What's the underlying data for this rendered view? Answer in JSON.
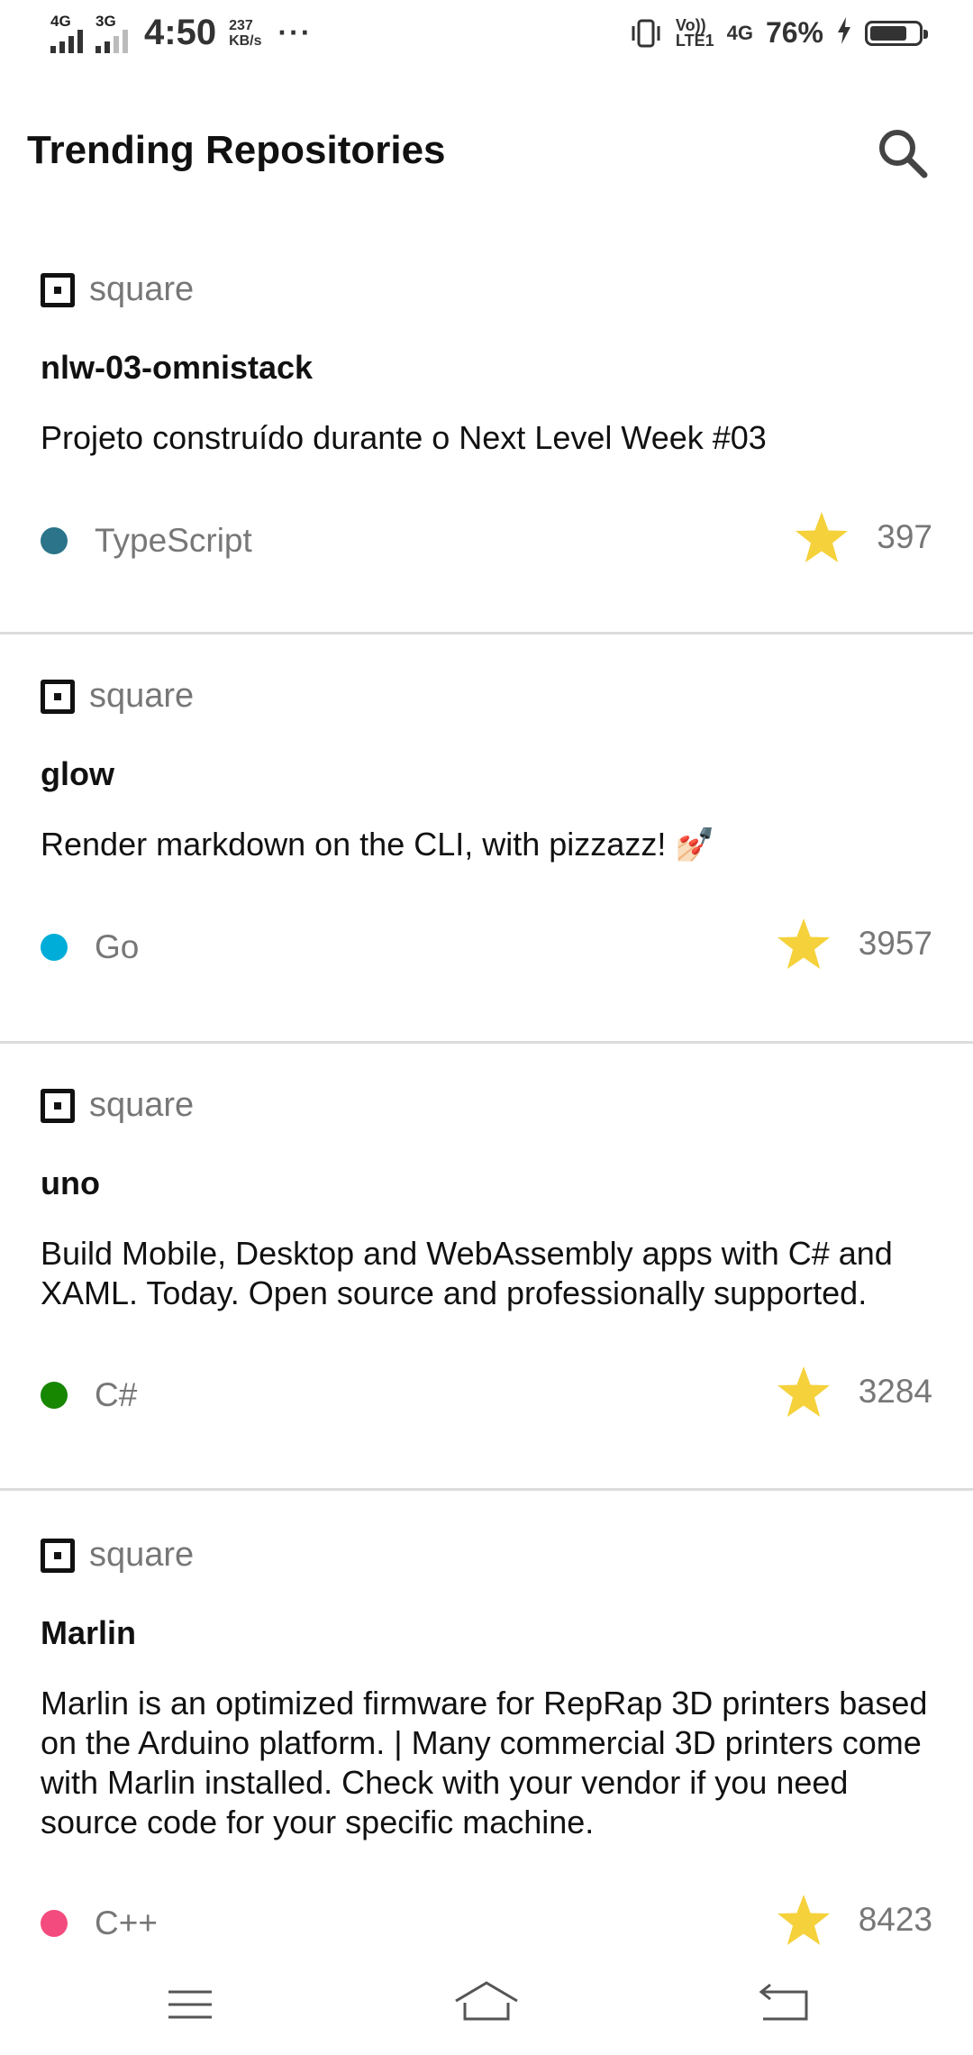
{
  "status_bar": {
    "sim1": "4G",
    "sim2": "3G",
    "time": "4:50",
    "speed_value": "237",
    "speed_unit": "KB/s",
    "more": "···",
    "volte_top": "Vo))",
    "volte_bottom": "LTE1",
    "network": "4G",
    "battery_percent": "76%",
    "battery_level": 0.76
  },
  "app_bar": {
    "title": "Trending Repositories",
    "search_icon": "search-icon"
  },
  "repositories": [
    {
      "owner": "square",
      "name": "nlw-03-omnistack",
      "description": "Projeto construído durante o Next Level Week #03",
      "language": "TypeScript",
      "language_color": "#2b7489",
      "stars": "397"
    },
    {
      "owner": "square",
      "name": "glow",
      "description": "Render markdown on the CLI, with pizzazz! 💅🏻",
      "language": "Go",
      "language_color": "#00ADD8",
      "stars": "3957"
    },
    {
      "owner": "square",
      "name": "uno",
      "description": "Build Mobile, Desktop and WebAssembly apps with C# and XAML. Today. Open source and professionally supported.",
      "language": "C#",
      "language_color": "#178600",
      "stars": "3284"
    },
    {
      "owner": "square",
      "name": "Marlin",
      "description": "Marlin is an optimized firmware for RepRap 3D printers based on the Arduino platform. | Many commercial 3D printers come with Marlin installed. Check with your vendor if you need source code for your specific machine.",
      "language": "C++",
      "language_color": "#f34b7d",
      "stars": "8423"
    }
  ],
  "colors": {
    "star": "#f5d13b",
    "divider": "#dcdcdc"
  },
  "nav_bar": {
    "menu_icon": "menu-icon",
    "home_icon": "home-icon",
    "back_icon": "back-icon"
  }
}
